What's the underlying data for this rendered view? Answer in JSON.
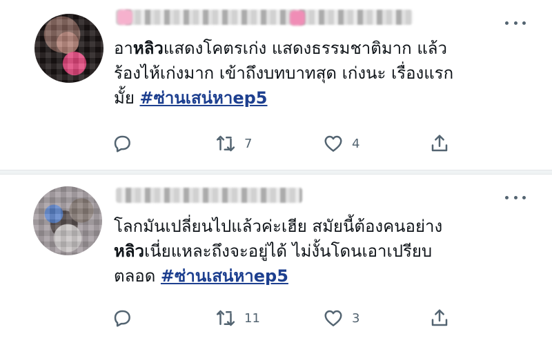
{
  "tweets": [
    {
      "text_parts": {
        "p1": "อา",
        "bold": "หลิว",
        "p2": "แสดงโคตรเก่ง แสดงธรรมชาติมาก แล้ว",
        "line2": "ร้องไห้เก่งมาก เข้าถึงบทบาทสุด เก่งนะ เรื่องแรก",
        "p3": "มั้ย ",
        "hashtag": "#ซ่านเสน่หาep5"
      },
      "retweet_count": "7",
      "like_count": "4"
    },
    {
      "text_parts": {
        "line1": "โลกมันเปลี่ยนไปแล้วค่ะเฮีย สมัยนี้ต้องคนอย่าง",
        "bold": "หลิว",
        "p2": "เนี่ยแหละถึงจะอยู่ได้ ไม่งั้นโดนเอาเปรียบ",
        "p3": "ตลอด ",
        "hashtag": "#ซ่านเสน่หาep5"
      },
      "retweet_count": "11",
      "like_count": "3"
    }
  ],
  "icons": {
    "reply": "reply-icon",
    "retweet": "retweet-icon",
    "like": "heart-icon",
    "share": "share-icon",
    "more": "more-icon"
  },
  "colors": {
    "hashtag": "#1d3f8f",
    "icon": "#536471",
    "text": "#0f1419"
  }
}
